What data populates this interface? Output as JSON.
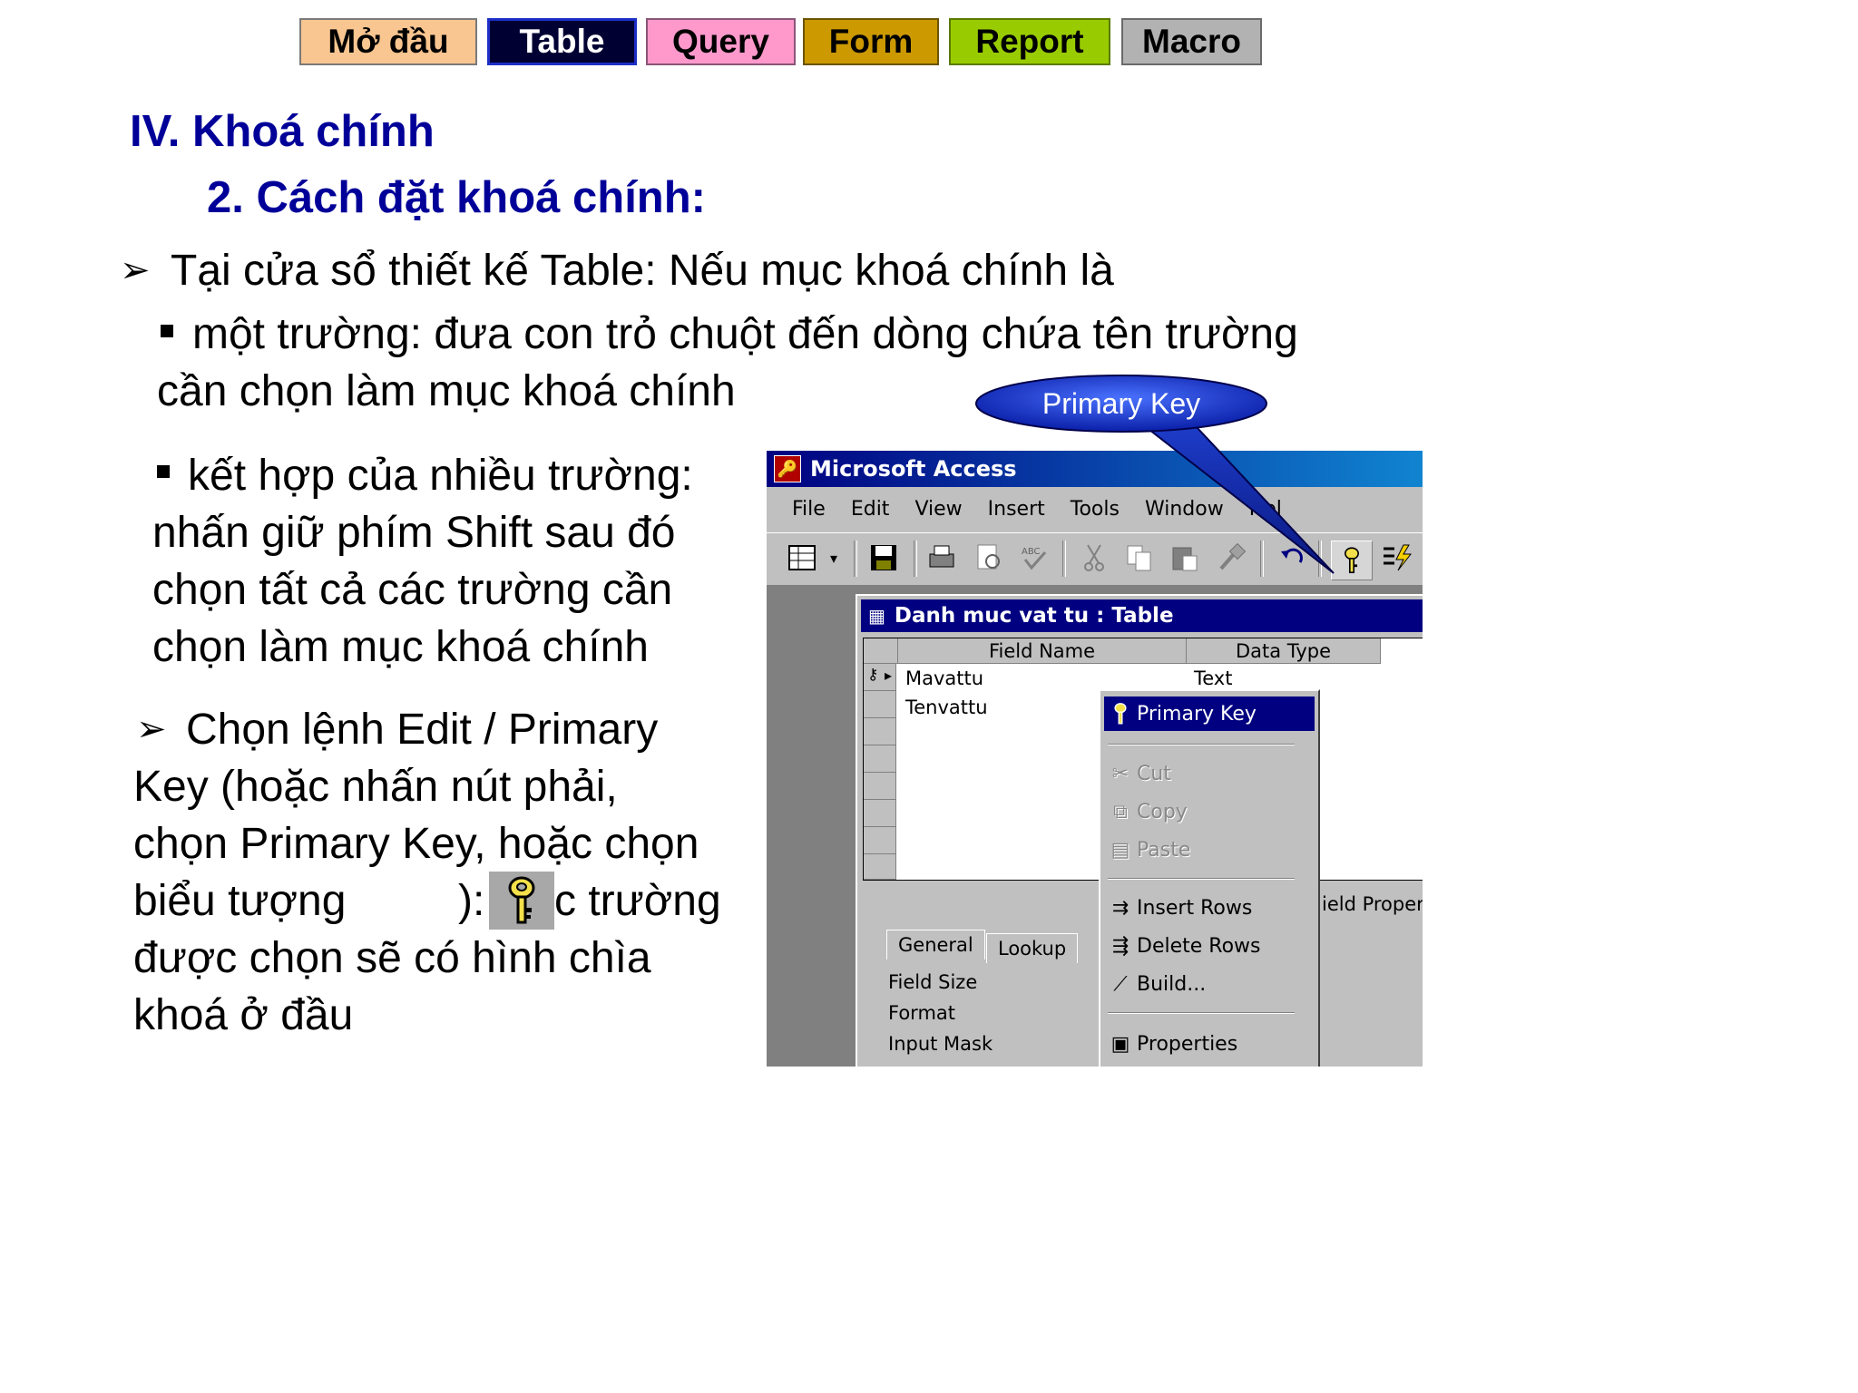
{
  "nav": [
    "Mở đầu",
    "Table",
    "Query",
    "Form",
    "Report",
    "Macro"
  ],
  "heading1": "IV. Khoá chính",
  "heading2": "2. Cách đặt khoá chính:",
  "para1": "Tại cửa sổ thiết kế Table: Nếu mục khoá chính là",
  "bullet1": {
    "line1": "một trường: đưa con trỏ chuột đến dòng chứa tên trường",
    "line2": "cần chọn làm mục khoá chính"
  },
  "bullet2": {
    "line1": "kết hợp của nhiều trường:",
    "line2": "nhấn giữ phím Shift sau đó",
    "line3": "chọn tất cả các trường cần",
    "line4": "chọn làm mục khoá chính"
  },
  "para2": {
    "line1": "Chọn lệnh Edit / Primary",
    "line2": "Key (hoặc nhấn nút phải,",
    "line3": "chọn Primary Key, hoặc chọn",
    "line4a": "biểu tượng",
    "line4b": "):",
    "line4c": "c trường",
    "line5": "được chọn sẽ có hình chìa",
    "line6": "khoá ở đầu"
  },
  "callout": "Primary Key",
  "access": {
    "title": "Microsoft Access",
    "menu": [
      "File",
      "Edit",
      "View",
      "Insert",
      "Tools",
      "Window",
      "Hel"
    ],
    "table_title": "Danh muc vat tu : Table",
    "columns": [
      "Field Name",
      "Data Type"
    ],
    "rows": [
      {
        "field": "Mavattu",
        "type": "Text"
      },
      {
        "field": "Tenvattu",
        "type": ""
      }
    ],
    "field_props_label": "ield Proper",
    "tabs": [
      "General",
      "Lookup"
    ],
    "props": [
      "Field Size",
      "Format",
      "Input Mask"
    ]
  },
  "context_menu": {
    "items": [
      {
        "label": "Primary Key",
        "icon": "key-icon",
        "state": "selected"
      },
      {
        "label": "Cut",
        "icon": "scissors-icon",
        "state": "disabled"
      },
      {
        "label": "Copy",
        "icon": "copy-icon",
        "state": "disabled"
      },
      {
        "label": "Paste",
        "icon": "paste-icon",
        "state": "disabled"
      },
      {
        "label": "Insert Rows",
        "icon": "insert-rows-icon",
        "state": "enabled"
      },
      {
        "label": "Delete Rows",
        "icon": "delete-rows-icon",
        "state": "enabled"
      },
      {
        "label": "Build...",
        "icon": "wand-icon",
        "state": "enabled"
      },
      {
        "label": "Properties",
        "icon": "properties-icon",
        "state": "enabled"
      }
    ]
  },
  "colors": {
    "heading": "#000099",
    "callout_fill": "#1a3cc8",
    "titlebar": "#000080"
  }
}
